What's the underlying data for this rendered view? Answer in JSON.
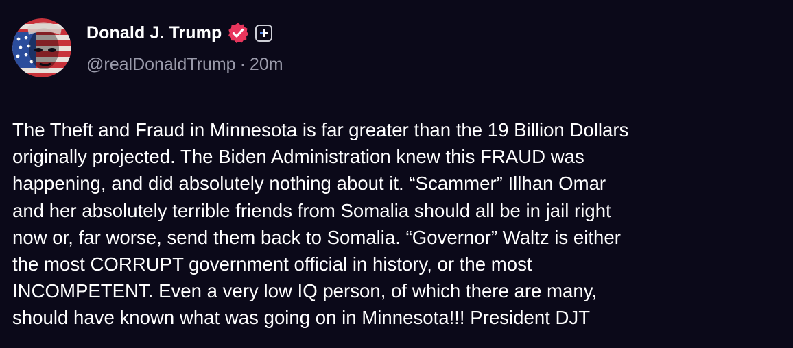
{
  "author": {
    "display_name": "Donald J. Trump",
    "handle": "@realDonaldTrump",
    "separator": "·",
    "time_ago": "20m",
    "verified_icon": "verified-badge-icon",
    "plus_icon": "plus-badge-icon",
    "verified_color": "#e8365d"
  },
  "post": {
    "lines": [
      "The Theft and Fraud in Minnesota is far greater than the 19 Billion Dollars",
      "originally projected. The Biden Administration knew this FRAUD was",
      "happening, and did absolutely nothing about it. “Scammer” Illhan Omar",
      "and her absolutely terrible friends from Somalia should all be in jail right",
      "now or, far worse, send them back to Somalia. “Governor” Waltz is either",
      "the most CORRUPT government official in history, or the most",
      "INCOMPETENT. Even a very low IQ person, of which there are many,",
      "should have known what was going on in Minnesota!!! President DJT"
    ]
  },
  "colors": {
    "background": "#0b0919",
    "text": "#ffffff",
    "muted": "#9a9aaa"
  }
}
